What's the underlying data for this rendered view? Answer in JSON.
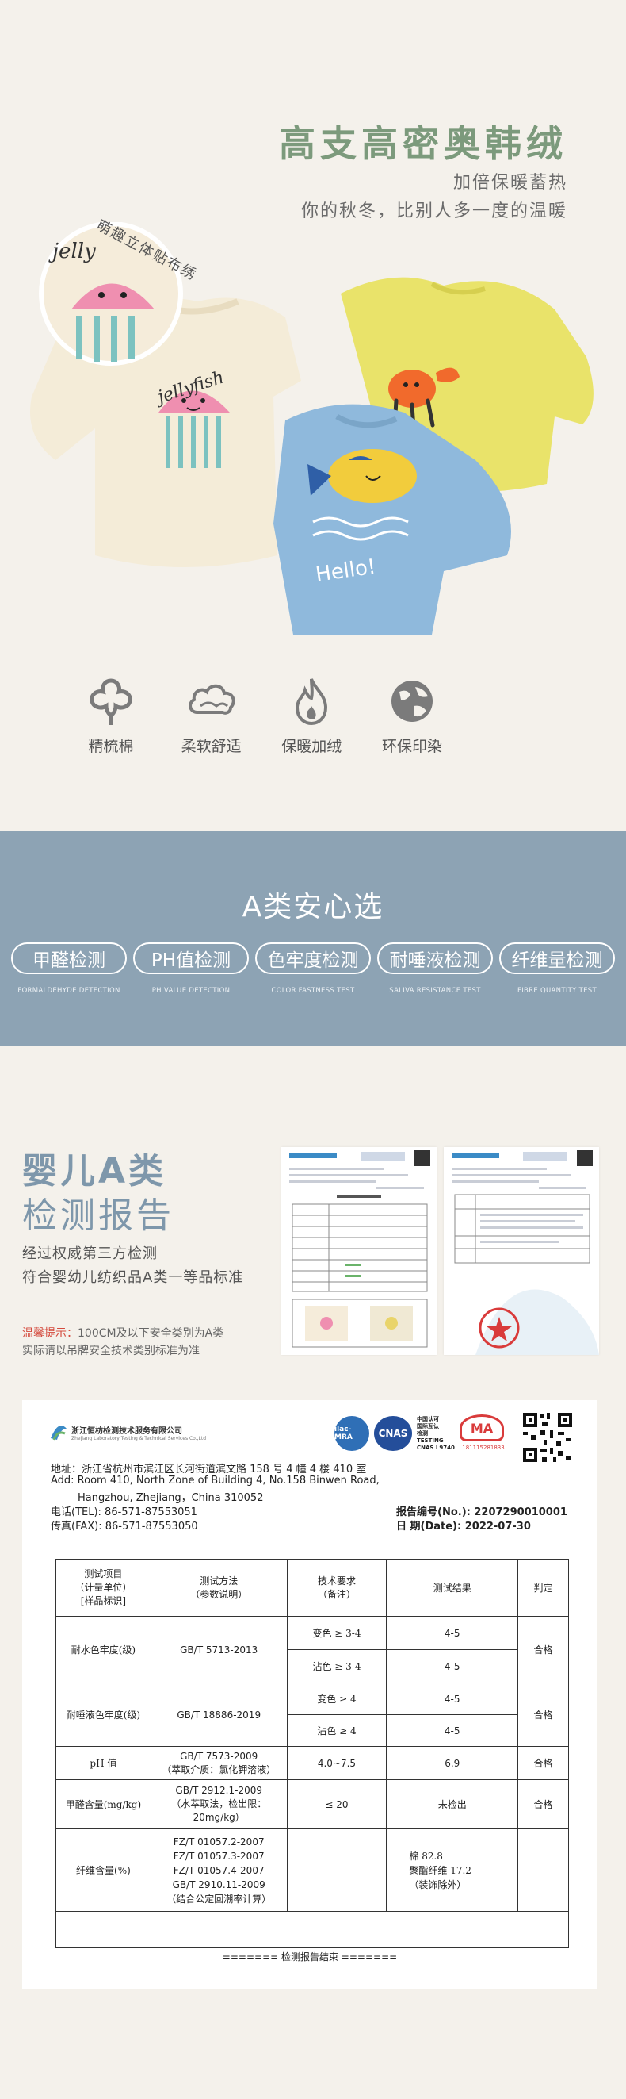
{
  "hero": {
    "title": "高支高密奥韩绒",
    "subtitle_1": "加倍保暖蓄热",
    "subtitle_2": "你的秋冬，比别人多一度的温暖",
    "callout": "萌趣立体贴布绣",
    "garment_text_jellyfish": "jellyfish",
    "garment_text_hello": "Hello!",
    "features": [
      {
        "icon": "cotton-icon",
        "label": "精梳棉"
      },
      {
        "icon": "cloud-icon",
        "label": "柔软舒适"
      },
      {
        "icon": "flame-icon",
        "label": "保暖加绒"
      },
      {
        "icon": "globe-icon",
        "label": "环保印染"
      }
    ]
  },
  "band": {
    "title": "A类安心选",
    "tests": [
      {
        "label": "甲醛检测",
        "en": "FORMALDEHYDE DETECTION"
      },
      {
        "label": "PH值检测",
        "en": "PH VALUE DETECTION"
      },
      {
        "label": "色牢度检测",
        "en": "COLOR FASTNESS TEST"
      },
      {
        "label": "耐唾液检测",
        "en": "SALIVA RESISTANCE TEST"
      },
      {
        "label": "纤维量检测",
        "en": "FIBRE QUANTITY TEST"
      }
    ]
  },
  "report": {
    "title_1": "婴儿A类",
    "title_2": "检测报告",
    "desc_1": "经过权威第三方检测",
    "desc_2": "符合婴幼儿纺织品A类一等品标准",
    "warn_label": "温馨提示：",
    "warn_1": "100CM及以下安全类别为A类",
    "warn_2": "实际请以吊牌安全技术类别标准为准"
  },
  "certificate": {
    "org_name": "浙江恒枋检测技术服务有限公司",
    "org_en": "Zhejiang Laboratory Testing & Technical Services Co.,Ltd",
    "badges": [
      "ilac-MRA",
      "CNAS",
      "MA"
    ],
    "cnas_text": "中国认可\n国际互认\n检测\nTESTING\nCNAS L9740",
    "ma_no": "181115281833",
    "addr_cn": "地址：浙江省杭州市滨江区长河街道滨文路 158 号 4 幢 4 楼 410 室",
    "addr_en_1": "Add: Room 410, North Zone of Building 4, No.158 Binwen Road,",
    "addr_en_2": "Hangzhou, Zhejiang，China          310052",
    "tel": "电话(TEL):      86-571-87553051",
    "fax": "传真(FAX):      86-571-87553050",
    "report_no": "报告编号(No.): 2207290010001",
    "report_date": "日    期(Date): 2022-07-30",
    "headers": [
      "测试项目\n（计量单位）\n[样品标识]",
      "测试方法\n（参数说明）",
      "技术要求\n（备注）",
      "测试结果",
      "判定"
    ],
    "rows": [
      {
        "item": "耐水色牢度(级)",
        "method": "GB/T 5713-2013",
        "reqs": [
          "变色 ≥ 3-4",
          "沾色 ≥ 3-4"
        ],
        "results": [
          "4-5",
          "4-5"
        ],
        "verdict": "合格"
      },
      {
        "item": "耐唾液色牢度(级)",
        "method": "GB/T 18886-2019",
        "reqs": [
          "变色 ≥ 4",
          "沾色 ≥ 4"
        ],
        "results": [
          "4-5",
          "4-5"
        ],
        "verdict": "合格"
      },
      {
        "item": "pH 值",
        "method": "GB/T 7573-2009\n（萃取介质：氯化钾溶液）",
        "reqs": [
          "4.0~7.5"
        ],
        "results": [
          "6.9"
        ],
        "verdict": "合格"
      },
      {
        "item": "甲醛含量(mg/kg)",
        "method": "GB/T 2912.1-2009\n（水萃取法，检出限：\n20mg/kg）",
        "reqs": [
          "≤ 20"
        ],
        "results": [
          "未检出"
        ],
        "verdict": "合格"
      },
      {
        "item": "纤维含量(%)",
        "method": "FZ/T 01057.2-2007\nFZ/T 01057.3-2007\nFZ/T 01057.4-2007\nGB/T 2910.11-2009\n（结合公定回潮率计算）",
        "reqs": [
          "--"
        ],
        "results": [
          "棉              82.8\n聚酯纤维      17.2\n（装饰除外）"
        ],
        "verdict": "--"
      }
    ],
    "end_text": "======= 检测报告结束 ======="
  }
}
